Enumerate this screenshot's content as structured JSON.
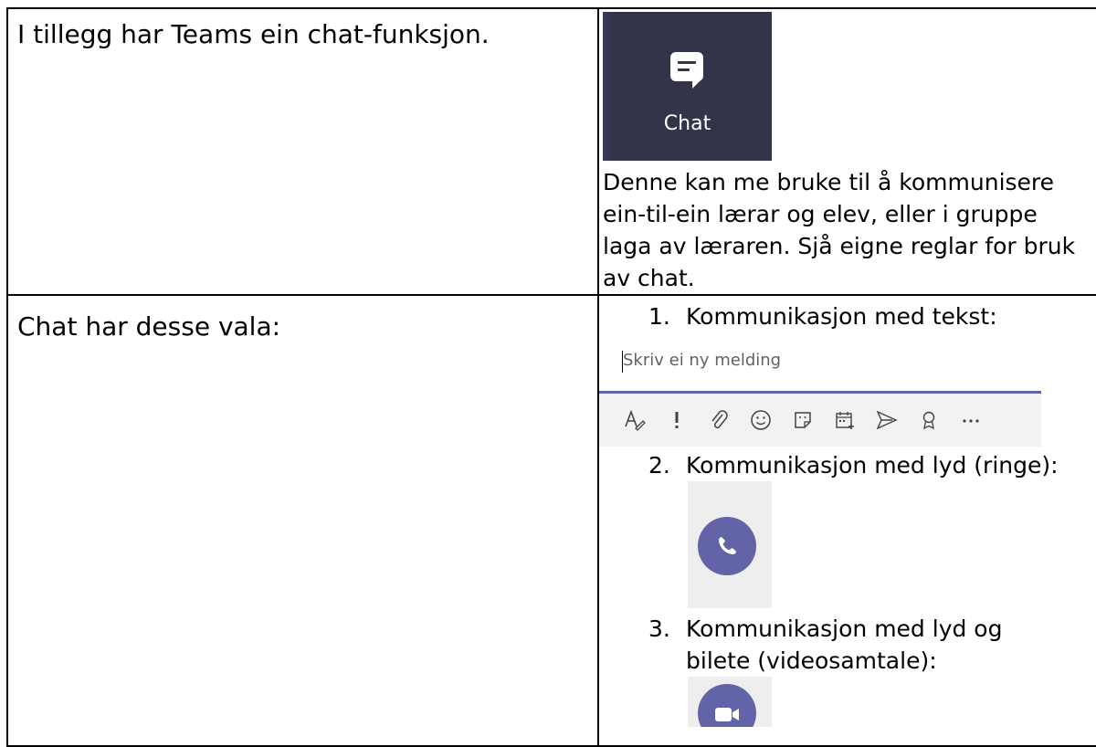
{
  "rows": [
    {
      "left_text": "I tillegg har Teams ein chat-funksjon.",
      "chat_tile_label": "Chat",
      "description": "Denne kan me bruke til å kommunisere ein-til-ein lærar og elev, eller i gruppe laga av læraren. Sjå eigne reglar for bruk av chat."
    },
    {
      "left_text": "Chat har desse vala:",
      "items": [
        {
          "number": "1.",
          "text": "Kommunikasjon med tekst:"
        },
        {
          "number": "2.",
          "text": "Kommunikasjon med lyd (ringe):"
        },
        {
          "number": "3.",
          "text": "Kommunikasjon med lyd og bilete (videosamtale):"
        }
      ],
      "compose": {
        "placeholder": "Skriv ei ny melding",
        "accent": "#6264a7",
        "toolbar_icons": [
          "format-icon",
          "important-icon",
          "attach-icon",
          "emoji-icon",
          "sticker-icon",
          "schedule-meeting-icon",
          "send-icon",
          "praise-icon",
          "more-icon"
        ]
      },
      "call_button_color": "#6264a7"
    }
  ]
}
